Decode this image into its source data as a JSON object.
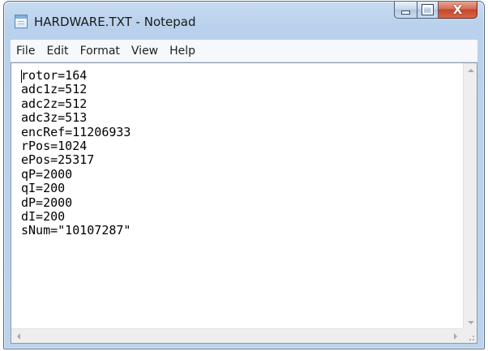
{
  "window": {
    "title": "HARDWARE.TXT - Notepad",
    "icon": "notepad-icon"
  },
  "caption_buttons": {
    "minimize_icon": "minimize-icon",
    "maximize_icon": "maximize-icon",
    "close_icon": "close-icon",
    "close_glyph": "X",
    "close_color": "#c9462a"
  },
  "menu": {
    "items": [
      {
        "label": "File"
      },
      {
        "label": "Edit"
      },
      {
        "label": "Format"
      },
      {
        "label": "View"
      },
      {
        "label": "Help"
      }
    ]
  },
  "editor": {
    "content": "rotor=164\nadc1z=512\nadc2z=512\nadc3z=513\nencRef=11206933\nrPos=1024\nePos=25317\nqP=2000\nqI=200\ndP=2000\ndI=200\nsNum=\"10107287\""
  },
  "colors": {
    "frame": "#b9d1ec",
    "menubar": "#f6f8fb",
    "editor_bg": "#ffffff"
  }
}
